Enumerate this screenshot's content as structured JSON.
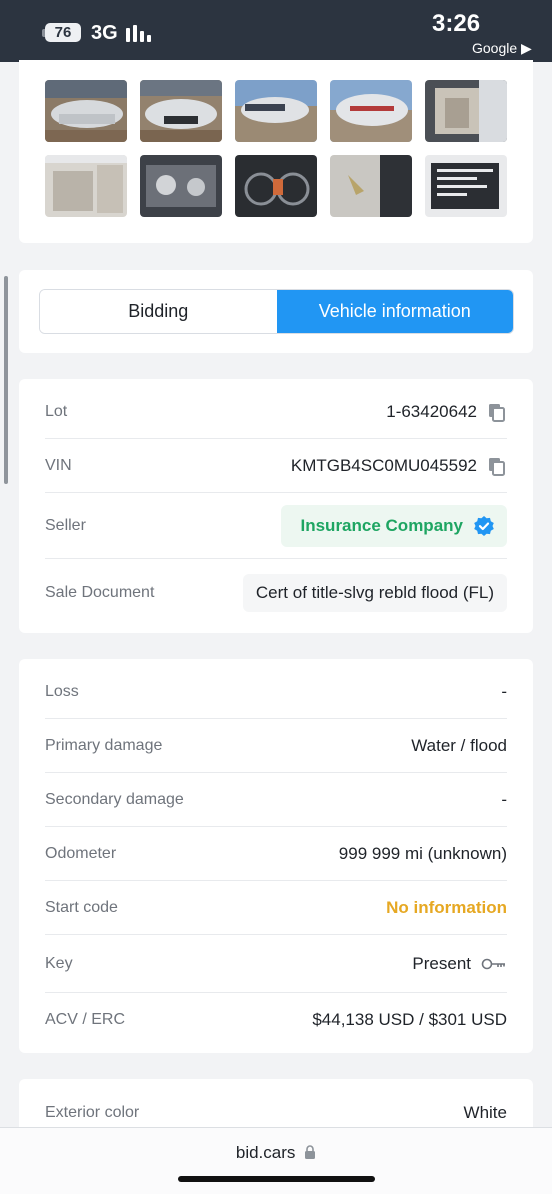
{
  "status_bar": {
    "battery": "76",
    "network": "3G",
    "time": "3:26",
    "back_app": "Google ▶"
  },
  "tabs": [
    {
      "label": "Bidding",
      "active": false
    },
    {
      "label": "Vehicle information",
      "active": true
    }
  ],
  "details": {
    "lot": {
      "label": "Lot",
      "value": "1-63420642"
    },
    "vin": {
      "label": "VIN",
      "value": "KMTGB4SC0MU045592"
    },
    "seller": {
      "label": "Seller",
      "value": "Insurance Company"
    },
    "sale_document": {
      "label": "Sale Document",
      "value": "Cert of title-slvg rebld flood (FL)"
    }
  },
  "condition": {
    "loss": {
      "label": "Loss",
      "value": "-"
    },
    "primary_damage": {
      "label": "Primary damage",
      "value": "Water / flood"
    },
    "secondary_damage": {
      "label": "Secondary damage",
      "value": "-"
    },
    "odometer": {
      "label": "Odometer",
      "value": "999 999 mi (unknown)"
    },
    "start_code": {
      "label": "Start code",
      "value": "No information"
    },
    "key": {
      "label": "Key",
      "value": "Present"
    },
    "acv_erc": {
      "label": "ACV / ERC",
      "value": "$44,138 USD / $301 USD"
    }
  },
  "exterior": {
    "label": "Exterior color",
    "value": "White"
  },
  "url_bar": {
    "domain": "bid.cars"
  },
  "colors": {
    "accent": "#2196f3",
    "seller_green": "#1ea562",
    "warning_yellow": "#e6a823",
    "status_bar": "#2c3440"
  }
}
